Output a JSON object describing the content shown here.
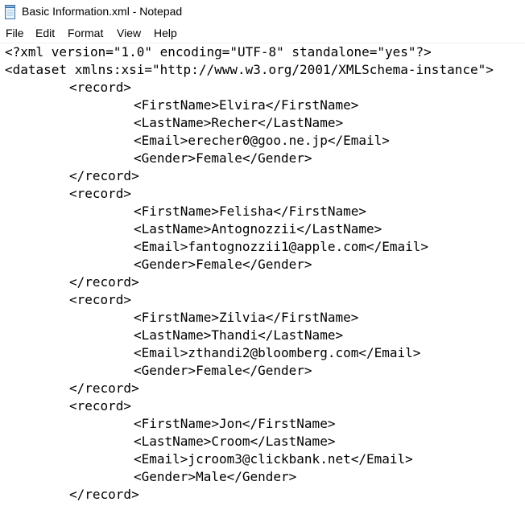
{
  "window": {
    "title": "Basic Information.xml - Notepad"
  },
  "menu": {
    "items": [
      "File",
      "Edit",
      "Format",
      "View",
      "Help"
    ]
  },
  "editor": {
    "lines": [
      "<?xml version=\"1.0\" encoding=\"UTF-8\" standalone=\"yes\"?>",
      "<dataset xmlns:xsi=\"http://www.w3.org/2001/XMLSchema-instance\">",
      "\t<record>",
      "\t\t<FirstName>Elvira</FirstName>",
      "\t\t<LastName>Recher</LastName>",
      "\t\t<Email>erecher0@goo.ne.jp</Email>",
      "\t\t<Gender>Female</Gender>",
      "\t</record>",
      "\t<record>",
      "\t\t<FirstName>Felisha</FirstName>",
      "\t\t<LastName>Antognozzii</LastName>",
      "\t\t<Email>fantognozzii1@apple.com</Email>",
      "\t\t<Gender>Female</Gender>",
      "\t</record>",
      "\t<record>",
      "\t\t<FirstName>Zilvia</FirstName>",
      "\t\t<LastName>Thandi</LastName>",
      "\t\t<Email>zthandi2@bloomberg.com</Email>",
      "\t\t<Gender>Female</Gender>",
      "\t</record>",
      "\t<record>",
      "\t\t<FirstName>Jon</FirstName>",
      "\t\t<LastName>Croom</LastName>",
      "\t\t<Email>jcroom3@clickbank.net</Email>",
      "\t\t<Gender>Male</Gender>",
      "\t</record>"
    ]
  }
}
